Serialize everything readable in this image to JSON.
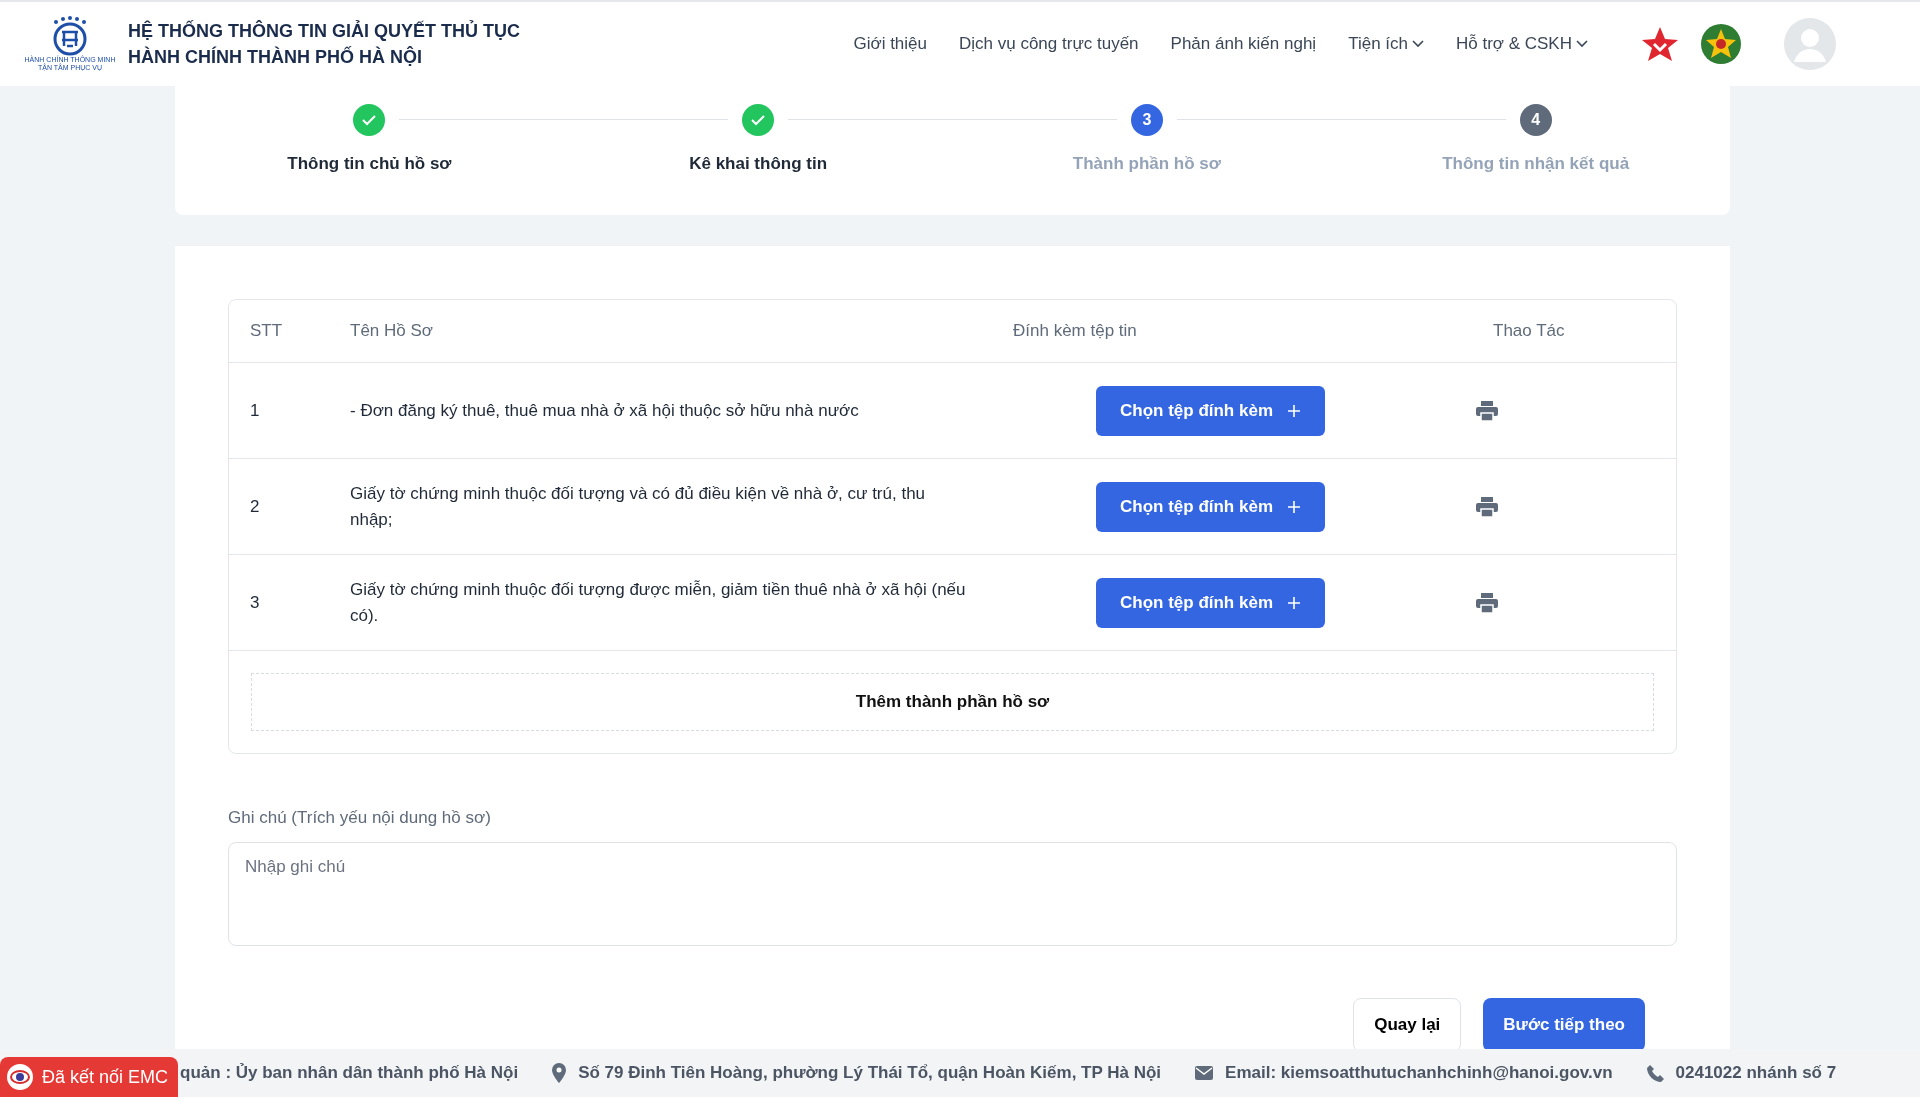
{
  "header": {
    "title_lines": [
      "HỆ THỐNG THÔNG TIN GIẢI QUYẾT THỦ TỤC",
      "HÀNH CHÍNH THÀNH PHỐ HÀ NỘI"
    ],
    "logo_caption": [
      "HÀNH CHÍNH THÔNG MINH",
      "TẬN TÂM PHỤC VỤ"
    ],
    "nav": [
      {
        "label": "Giới thiệu",
        "dropdown": false
      },
      {
        "label": "Dịch vụ công trực tuyến",
        "dropdown": false
      },
      {
        "label": "Phản ánh kiến nghị",
        "dropdown": false
      },
      {
        "label": "Tiện ích",
        "dropdown": true
      },
      {
        "label": "Hỗ trợ & CSKH",
        "dropdown": true
      }
    ]
  },
  "steps": [
    {
      "label": "Thông tin chủ hồ sơ",
      "completed": true,
      "selected": false
    },
    {
      "label": "Kê khai thông tin",
      "completed": true,
      "selected": false
    },
    {
      "number": "3",
      "label": "Thành phần hồ sơ",
      "completed": false,
      "selected": true
    },
    {
      "number": "4",
      "label": "Thông tin nhận kết quả",
      "completed": false,
      "selected": false
    }
  ],
  "table": {
    "columns": [
      "STT",
      "Tên Hồ Sơ",
      "Đính kèm tệp tin",
      "Thao Tác"
    ],
    "rows": [
      {
        "index": "1",
        "name": "- Đơn đăng ký thuê, thuê mua nhà ở xã hội thuộc sở hữu nhà nước",
        "button": "Chọn tệp đính kèm"
      },
      {
        "index": "2",
        "name": "Giấy tờ chứng minh thuộc đối tượng và có đủ điều kiện về nhà ở, cư trú, thu nhập;",
        "button": "Chọn tệp đính kèm"
      },
      {
        "index": "3",
        "name": "Giấy tờ chứng minh thuộc đối tượng được miễn, giảm tiền thuê nhà ở xã hội (nếu có).",
        "button": "Chọn tệp đính kèm"
      }
    ],
    "add_label": "Thêm thành phần hồ sơ"
  },
  "note": {
    "label": "Ghi chú (Trích yếu nội dung hồ sơ)",
    "placeholder": "Nhập ghi chú"
  },
  "buttons": {
    "back": "Quay lại",
    "next": "Bước tiếp theo"
  },
  "emc_badge": "Đã kết nối EMC",
  "footer": [
    {
      "kind": "text",
      "text": "quản : Ủy ban nhân dân thành phố Hà Nội"
    },
    {
      "kind": "address",
      "text": "Số 79 Đinh Tiên Hoàng, phường Lý Thái Tổ, quận Hoàn Kiếm, TP Hà Nội"
    },
    {
      "kind": "email",
      "text": "Email: kiemsoatthutuchanhchinh@hanoi.gov.vn"
    },
    {
      "kind": "phone",
      "text": "0241022 nhánh số 7"
    }
  ]
}
